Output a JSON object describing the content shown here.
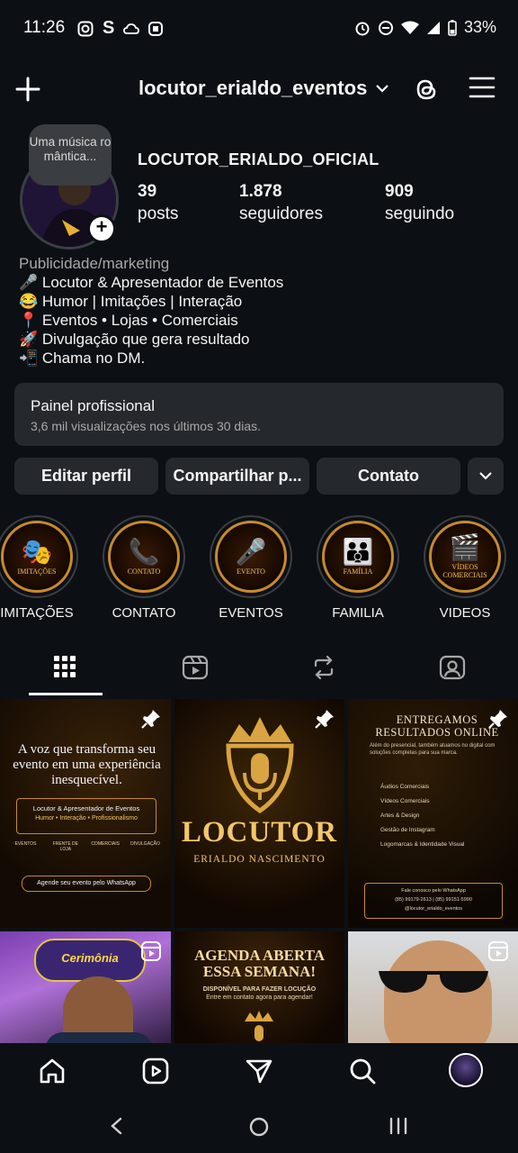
{
  "status_bar": {
    "time": "11:26",
    "battery": "33%"
  },
  "header": {
    "username": "locutor_erialdo_eventos"
  },
  "profile": {
    "note": "Uma música ro mântica...",
    "display_name": "LOCUTOR_ERIALDO_OFICIAL",
    "stats": [
      {
        "value": "39",
        "label": "posts"
      },
      {
        "value": "1.878",
        "label": "seguidores"
      },
      {
        "value": "909",
        "label": "seguindo"
      }
    ],
    "category": "Publicidade/marketing",
    "bio_lines": [
      "🎤 Locutor & Apresentador de Eventos",
      "😂 Humor | Imitações | Interação",
      "📍 Eventos • Lojas • Comerciais",
      "🚀 Divulgação que gera resultado",
      "📲 Chama no DM."
    ]
  },
  "dashboard": {
    "title": "Painel profissional",
    "subtitle": "3,6 mil visualizações nos últimos 30 dias."
  },
  "buttons": {
    "edit": "Editar perfil",
    "share": "Compartilhar p...",
    "contact": "Contato"
  },
  "highlights": [
    {
      "label": "IMITAÇÕES",
      "caption": "IMITAÇÕES",
      "icon": "theater-masks-icon"
    },
    {
      "label": "CONTATO",
      "caption": "CONTATO",
      "icon": "phone-chat-icon"
    },
    {
      "label": "EVENTOS",
      "caption": "EVENTO",
      "icon": "microphone-icon"
    },
    {
      "label": "FAMILIA",
      "caption": "FAMÍLIA",
      "icon": "family-icon"
    },
    {
      "label": "VIDEOS",
      "caption": "VÍDEOS COMERCIAIS",
      "icon": "clapperboard-icon"
    }
  ],
  "posts": {
    "p1": {
      "headline": "A voz que transforma seu evento em uma experiência inesquecível.",
      "box_title": "Locutor & Apresentador de Eventos",
      "box_sub": "Humor • Interação • Profissionalismo",
      "services": [
        "EVENTOS",
        "FRENTE DE LOJA",
        "COMERCIAIS",
        "DIVULGAÇÃO"
      ],
      "cta": "Agende seu evento pelo WhatsApp"
    },
    "p2": {
      "title": "LOCUTOR",
      "subtitle": "ERIALDO NASCIMENTO"
    },
    "p3": {
      "title": "ENTREGAMOS RESULTADOS ONLINE",
      "intro": "Além do presencial, também atuamos no digital com soluções completas para sua marca.",
      "items": [
        "Áudios Comerciais",
        "Vídeos Comerciais",
        "Artes & Design",
        "Gestão de Instagram",
        "Logomarcas & Identidade Visual"
      ],
      "footer_1": "Fale conosco pelo WhatsApp",
      "footer_2": "(85) 99179-2613 | (85) 99151-5990",
      "footer_3": "@locutor_erialdo_eventos"
    },
    "p4": {
      "logo_text": "Cerimônia"
    },
    "p5": {
      "title": "AGENDA ABERTA ESSA SEMANA!",
      "subtitle": "DISPONÍVEL PARA FAZER LOCUÇÃO",
      "subtitle_2": "Entre em contato agora para agendar!"
    }
  },
  "colors": {
    "background": "#0c1014",
    "surface": "#25292e",
    "gold": "#c88a2a"
  }
}
